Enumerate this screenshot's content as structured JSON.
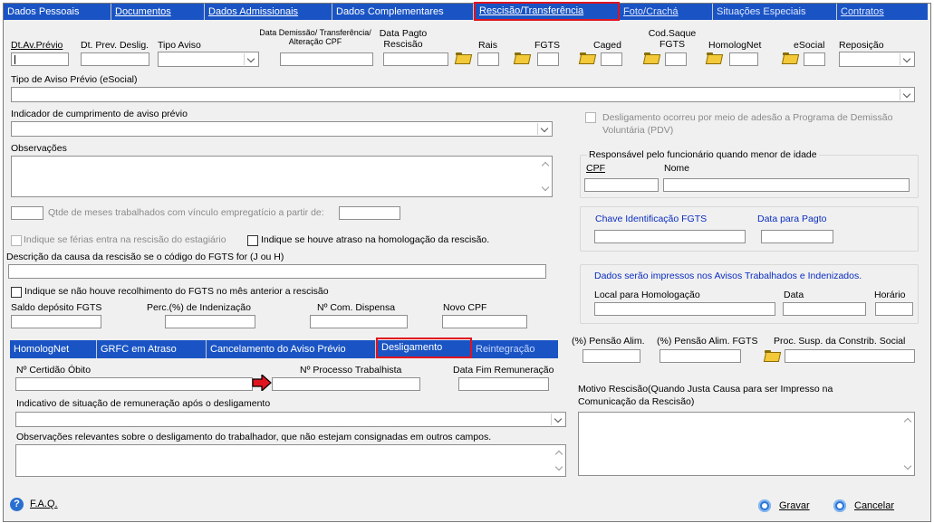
{
  "tabs": [
    {
      "label": "Dados Pessoais"
    },
    {
      "label": "Documentos"
    },
    {
      "label": "Dados Admissionais"
    },
    {
      "label": "Dados Complementares"
    },
    {
      "label": "Rescisão/Transferência"
    },
    {
      "label": "Foto/Crachá"
    },
    {
      "label": "Situações Especiais"
    },
    {
      "label": "Contratos"
    }
  ],
  "row1": {
    "dt_av_previo": "Dt.Av.Prévio",
    "dt_prev_deslig": "Dt. Prev. Deslig.",
    "tipo_aviso": "Tipo Aviso",
    "data_demissao": "Data Demissão/ Transferência/ Alteração CPF",
    "data_pagto_rescisao": "Data Pagto Rescisão",
    "rais": "Rais",
    "fgts": "FGTS",
    "caged": "Caged",
    "cod_saque_fgts": "Cod.Saque FGTS",
    "homolognet": "HomologNet",
    "esocial": "eSocial",
    "reposicao": "Reposição"
  },
  "tipo_aviso_esocial": "Tipo de Aviso Prévio (eSocial)",
  "indicador_cumprimento": "Indicador de cumprimento de aviso prévio",
  "observacoes": "Observações",
  "qtde_meses": "Qtde de meses trabalhados com vínculo empregatício a partir de:",
  "ferias_estagiario": "Indique se férias entra na rescisão do estagiário",
  "atraso_homologacao": "Indique se houve atraso na homologação da rescisão.",
  "descricao_causa": "Descrição da causa da rescisão se o código do FGTS for (J ou H)",
  "nao_recolhimento": "Indique se não houve recolhimento do FGTS no mês anterior a rescisão",
  "saldo_fgts": "Saldo depósito FGTS",
  "perc_indenizacao": "Perc.(%)  de Indenização",
  "n_com_dispensa": "Nº Com. Dispensa",
  "novo_cpf": "Novo CPF",
  "pdv": "Desligamento ocorreu por meio de adesão a Programa de Demissão Voluntária (PDV)",
  "responsavel": {
    "title": "Responsável pelo funcionário quando menor de idade",
    "cpf": "CPF",
    "nome": "Nome"
  },
  "fgts_group": {
    "chave": "Chave Identificação FGTS",
    "data_pagto": "Data para Pagto"
  },
  "avisos_group": {
    "info": "Dados serão impressos nos Avisos Trabalhados e Indenizados.",
    "local": "Local para Homologação",
    "data": "Data",
    "horario": "Horário"
  },
  "subtabs": [
    {
      "label": "HomologNet"
    },
    {
      "label": "GRFC em Atraso"
    },
    {
      "label": "Cancelamento do Aviso Prévio"
    },
    {
      "label": "Desligamento"
    },
    {
      "label": "Reintegração"
    }
  ],
  "desligamento": {
    "certidao_obito": "Nº Certidão Óbito",
    "processo_trabalhista": "Nº Processo Trabalhista",
    "data_fim_remuneracao": "Data Fim Remuneração",
    "indicativo": "Indicativo de situação de remuneração após o desligamento",
    "obs_relevantes": "Observações relevantes sobre o desligamento do trabalhador, que não estejam consignadas em outros campos."
  },
  "pensao_alim": "(%) Pensão Alim.",
  "pensao_alim_fgts": "(%) Pensão Alim. FGTS",
  "proc_susp": "Proc. Susp. da Constrib. Social",
  "motivo_rescisao": "Motivo Rescisão(Quando Justa Causa para ser Impresso na Comunicação da Rescisão)",
  "footer": {
    "faq": "F.A.Q.",
    "gravar": "Gravar",
    "cancelar": "Cancelar"
  },
  "colors": {
    "tab_blue": "#1a54c4",
    "highlight_red": "#e0141e",
    "label_blue": "#0a2dbf"
  }
}
